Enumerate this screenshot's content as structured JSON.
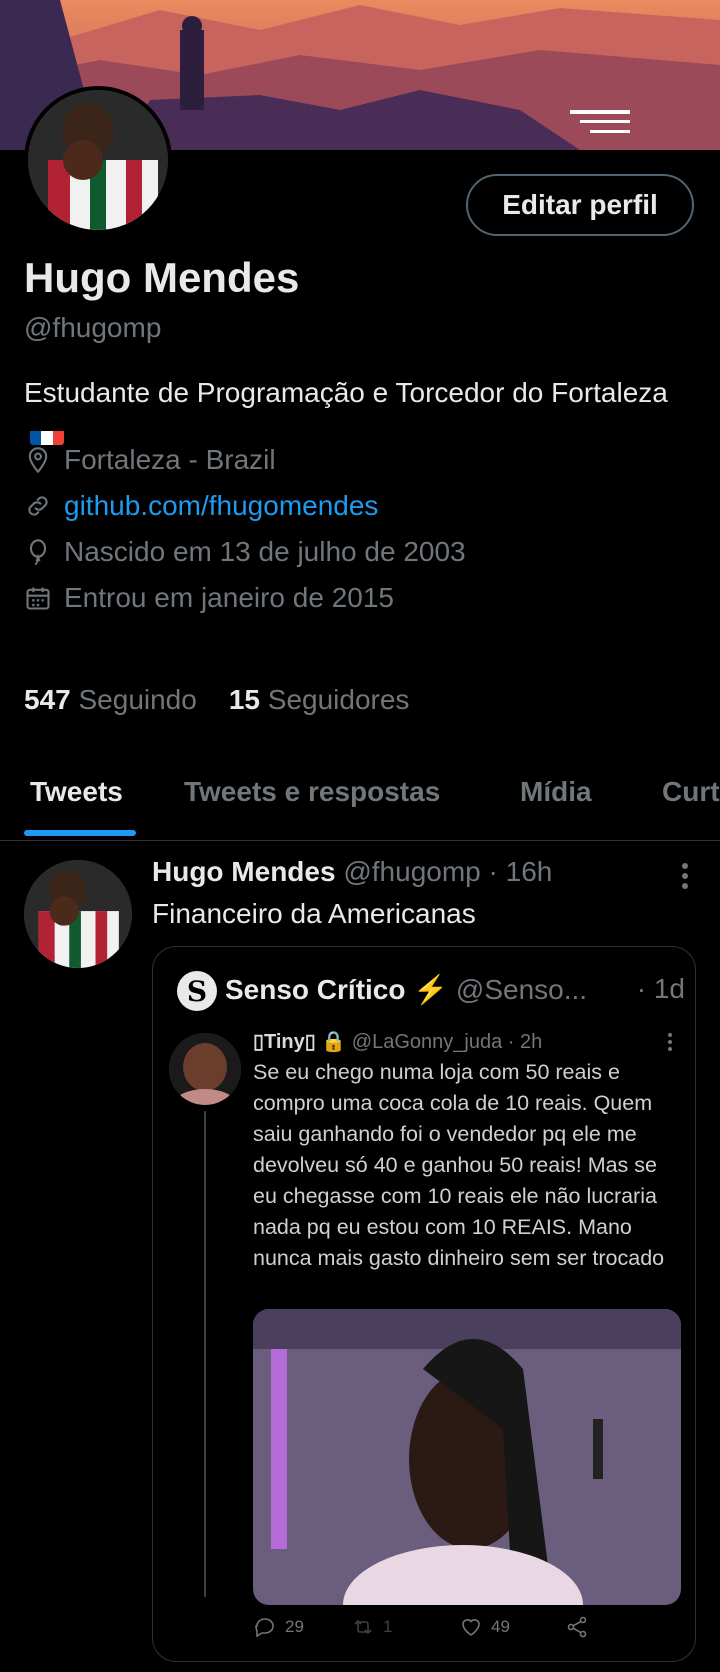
{
  "profile": {
    "edit_button": "Editar perfil",
    "name": "Hugo Mendes",
    "handle": "@fhugomp",
    "bio": "Estudante de Programação e Torcedor do Fortaleza",
    "location": "Fortaleza - Brazil",
    "website": "github.com/fhugomendes",
    "birthday": "Nascido em 13 de julho de 2003",
    "joined": "Entrou em janeiro de 2015",
    "following_count": "547",
    "following_label": "Seguindo",
    "followers_count": "15",
    "followers_label": "Seguidores"
  },
  "tabs": [
    "Tweets",
    "Tweets e respostas",
    "Mídia",
    "Curt"
  ],
  "tweet": {
    "name": "Hugo Mendes",
    "handle_time": "@fhugomp · 16h",
    "text": "Financeiro da Americanas",
    "quote": {
      "logo_letter": "S",
      "name": "Senso Crítico ⚡",
      "handle": "@Senso...",
      "time": "· 1d",
      "inner": {
        "name": "▯Tiny▯ 🔒",
        "handle_time": "@LaGonny_juda · 2h",
        "text": "Se eu chego numa loja com 50 reais e compro uma coca cola de 10 reais. Quem saiu ganhando foi o vendedor pq ele me devolveu só 40 e ganhou 50 reais! Mas se eu chegasse com 10 reais ele não lucraria nada pq eu estou com 10 REAIS. Mano nunca mais gasto dinheiro sem ser trocado",
        "replies": "29",
        "retweets": "1",
        "likes": "49"
      }
    }
  },
  "colors": {
    "accent": "#1d9bf0",
    "background": "#000000",
    "muted": "#71767b"
  }
}
